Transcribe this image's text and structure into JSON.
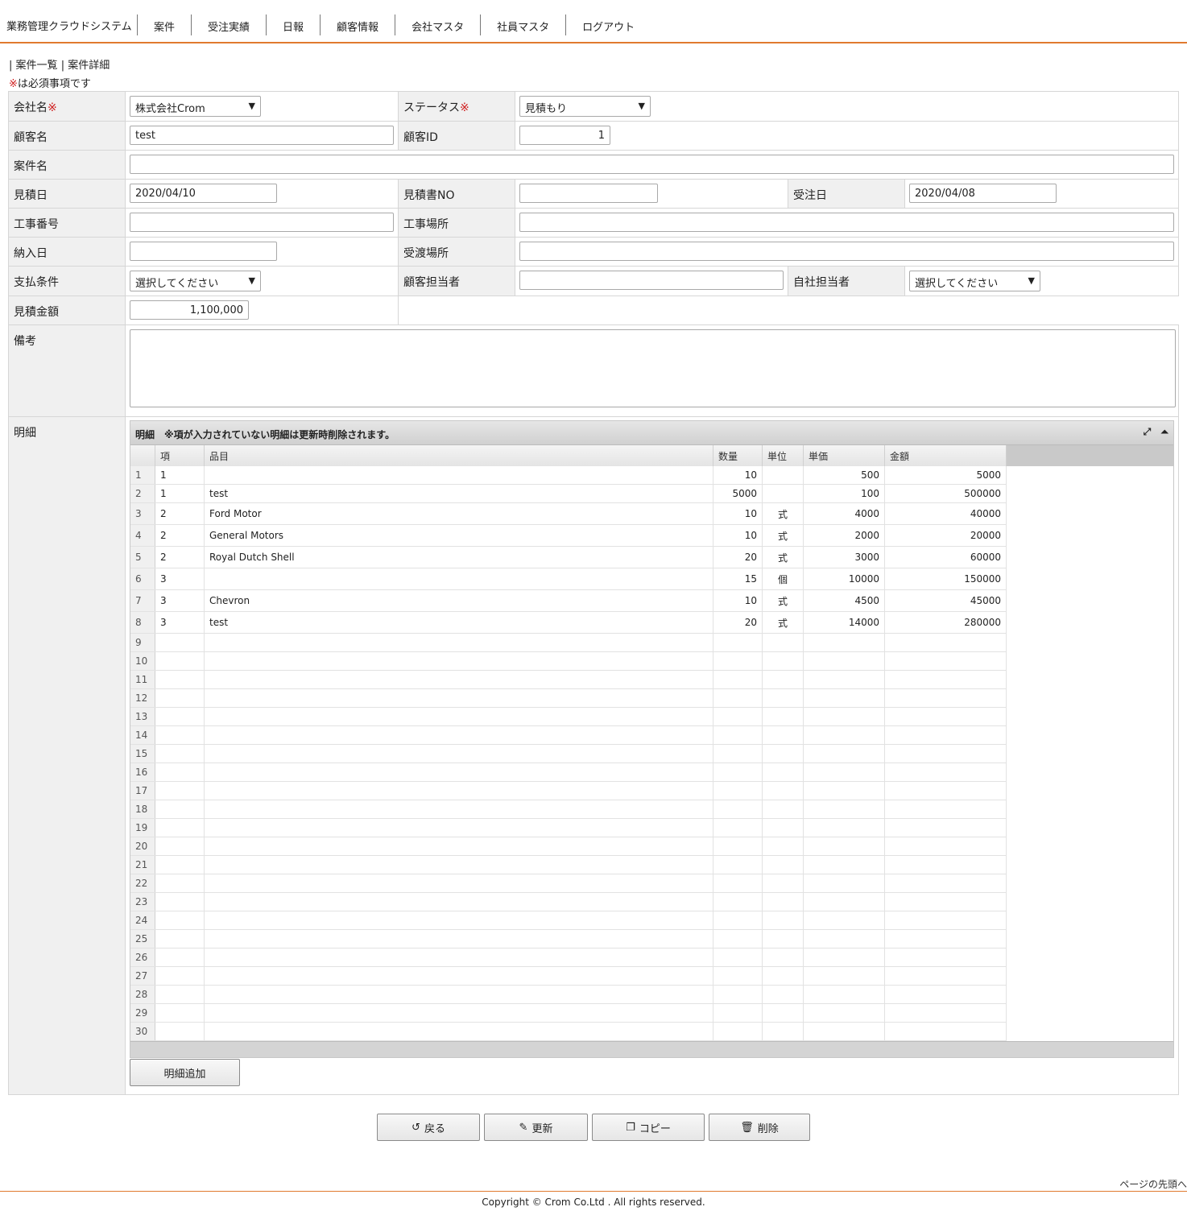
{
  "header": {
    "brand": "業務管理クラウドシステム",
    "nav": [
      "案件",
      "受注実績",
      "日報",
      "顧客情報",
      "会社マスタ",
      "社員マスタ",
      "ログアウト"
    ]
  },
  "breadcrumb": {
    "list": "案件一覧",
    "detail": "案件詳細",
    "sep": "|"
  },
  "required_note": {
    "mark": "※",
    "text": "は必須事項です"
  },
  "form": {
    "company": {
      "label": "会社名",
      "required": "※",
      "value": "株式会社Crom"
    },
    "status": {
      "label": "ステータス",
      "required": "※",
      "value": "見積もり"
    },
    "customer_name": {
      "label": "顧客名",
      "value": "test"
    },
    "customer_id": {
      "label": "顧客ID",
      "value": "1"
    },
    "project_name": {
      "label": "案件名",
      "value": ""
    },
    "estimate_date": {
      "label": "見積日",
      "value": "2020/04/10"
    },
    "estimate_no": {
      "label": "見積書NO",
      "value": ""
    },
    "order_date": {
      "label": "受注日",
      "value": "2020/04/08"
    },
    "work_no": {
      "label": "工事番号",
      "value": ""
    },
    "work_place": {
      "label": "工事場所",
      "value": ""
    },
    "delivery_date": {
      "label": "納入日",
      "value": ""
    },
    "handover_place": {
      "label": "受渡場所",
      "value": ""
    },
    "payment": {
      "label": "支払条件",
      "value": "選択してください"
    },
    "customer_contact": {
      "label": "顧客担当者",
      "value": ""
    },
    "own_contact": {
      "label": "自社担当者",
      "value": "選択してください"
    },
    "estimate_amount": {
      "label": "見積金額",
      "value": "1,100,000"
    },
    "remarks": {
      "label": "備考",
      "value": ""
    },
    "details": {
      "label": "明細"
    }
  },
  "grid": {
    "title": "明細　※項が入力されていない明細は更新時削除されます。",
    "columns": [
      "項",
      "品目",
      "数量",
      "単位",
      "単価",
      "金額"
    ],
    "row_numbers": [
      "1",
      "2",
      "3",
      "4",
      "5",
      "6",
      "7",
      "8",
      "9",
      "10",
      "11",
      "12",
      "13",
      "14",
      "15",
      "16",
      "17",
      "18",
      "19",
      "20",
      "21",
      "22",
      "23",
      "24",
      "25",
      "26",
      "27",
      "28",
      "29",
      "30"
    ],
    "rows": [
      [
        "1",
        "",
        "10",
        "",
        "500",
        "5000"
      ],
      [
        "1",
        "test",
        "5000",
        "",
        "100",
        "500000"
      ],
      [
        "2",
        "Ford Motor",
        "10",
        "式",
        "4000",
        "40000"
      ],
      [
        "2",
        "General Motors",
        "10",
        "式",
        "2000",
        "20000"
      ],
      [
        "2",
        "Royal Dutch Shell",
        "20",
        "式",
        "3000",
        "60000"
      ],
      [
        "3",
        "",
        "15",
        "個",
        "10000",
        "150000"
      ],
      [
        "3",
        "Chevron",
        "10",
        "式",
        "4500",
        "45000"
      ],
      [
        "3",
        "test",
        "20",
        "式",
        "14000",
        "280000"
      ]
    ],
    "add_button": "明細追加"
  },
  "actions": {
    "back": "戻る",
    "update": "更新",
    "copy": "コピー",
    "delete": "削除"
  },
  "footer": {
    "page_top": "ページの先頭へ",
    "copyright": "Copyright © Crom Co.Ltd . All rights reserved."
  }
}
